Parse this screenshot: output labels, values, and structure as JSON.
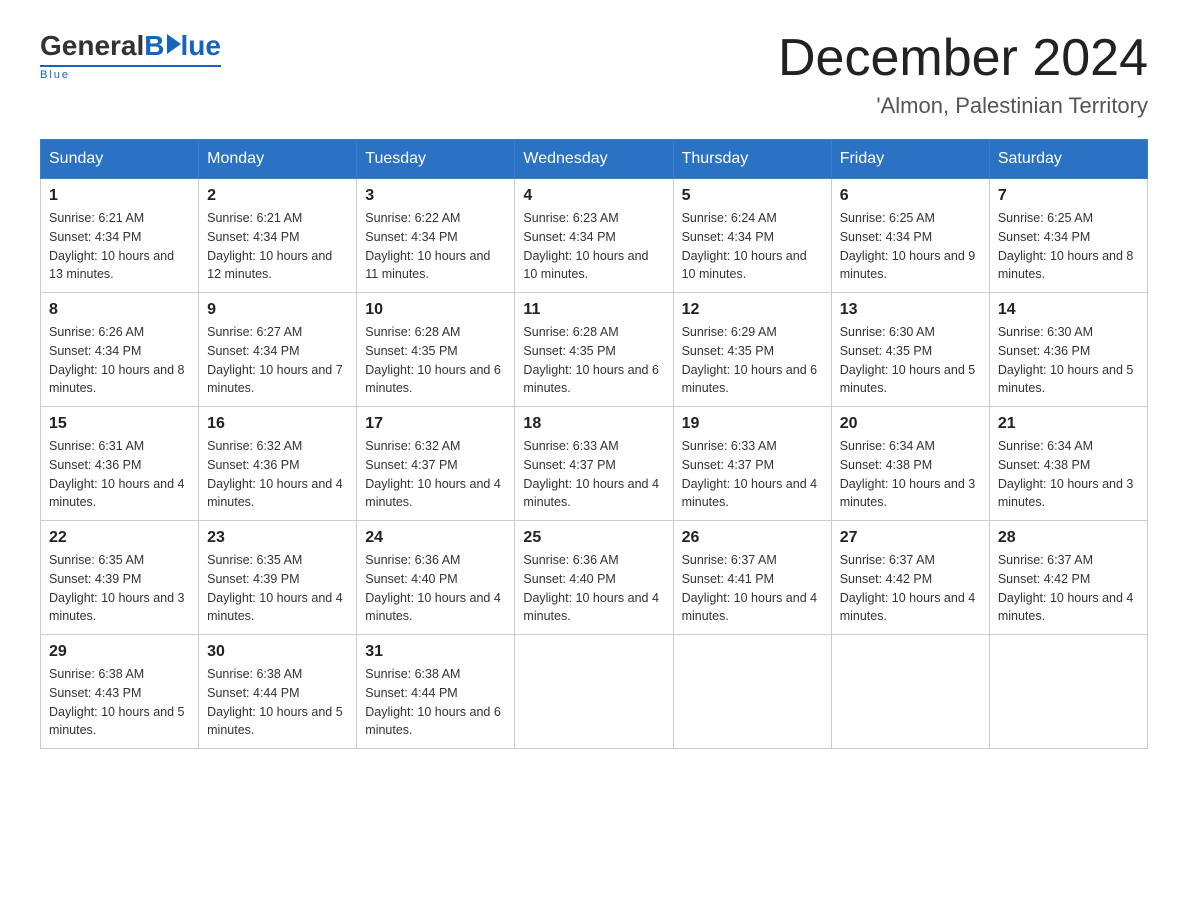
{
  "logo": {
    "general": "General",
    "blue": "Blue",
    "tagline": "Blue"
  },
  "header": {
    "month": "December 2024",
    "location": "'Almon, Palestinian Territory"
  },
  "days_of_week": [
    "Sunday",
    "Monday",
    "Tuesday",
    "Wednesday",
    "Thursday",
    "Friday",
    "Saturday"
  ],
  "weeks": [
    [
      {
        "day": "1",
        "sunrise": "6:21 AM",
        "sunset": "4:34 PM",
        "daylight": "10 hours and 13 minutes."
      },
      {
        "day": "2",
        "sunrise": "6:21 AM",
        "sunset": "4:34 PM",
        "daylight": "10 hours and 12 minutes."
      },
      {
        "day": "3",
        "sunrise": "6:22 AM",
        "sunset": "4:34 PM",
        "daylight": "10 hours and 11 minutes."
      },
      {
        "day": "4",
        "sunrise": "6:23 AM",
        "sunset": "4:34 PM",
        "daylight": "10 hours and 10 minutes."
      },
      {
        "day": "5",
        "sunrise": "6:24 AM",
        "sunset": "4:34 PM",
        "daylight": "10 hours and 10 minutes."
      },
      {
        "day": "6",
        "sunrise": "6:25 AM",
        "sunset": "4:34 PM",
        "daylight": "10 hours and 9 minutes."
      },
      {
        "day": "7",
        "sunrise": "6:25 AM",
        "sunset": "4:34 PM",
        "daylight": "10 hours and 8 minutes."
      }
    ],
    [
      {
        "day": "8",
        "sunrise": "6:26 AM",
        "sunset": "4:34 PM",
        "daylight": "10 hours and 8 minutes."
      },
      {
        "day": "9",
        "sunrise": "6:27 AM",
        "sunset": "4:34 PM",
        "daylight": "10 hours and 7 minutes."
      },
      {
        "day": "10",
        "sunrise": "6:28 AM",
        "sunset": "4:35 PM",
        "daylight": "10 hours and 6 minutes."
      },
      {
        "day": "11",
        "sunrise": "6:28 AM",
        "sunset": "4:35 PM",
        "daylight": "10 hours and 6 minutes."
      },
      {
        "day": "12",
        "sunrise": "6:29 AM",
        "sunset": "4:35 PM",
        "daylight": "10 hours and 6 minutes."
      },
      {
        "day": "13",
        "sunrise": "6:30 AM",
        "sunset": "4:35 PM",
        "daylight": "10 hours and 5 minutes."
      },
      {
        "day": "14",
        "sunrise": "6:30 AM",
        "sunset": "4:36 PM",
        "daylight": "10 hours and 5 minutes."
      }
    ],
    [
      {
        "day": "15",
        "sunrise": "6:31 AM",
        "sunset": "4:36 PM",
        "daylight": "10 hours and 4 minutes."
      },
      {
        "day": "16",
        "sunrise": "6:32 AM",
        "sunset": "4:36 PM",
        "daylight": "10 hours and 4 minutes."
      },
      {
        "day": "17",
        "sunrise": "6:32 AM",
        "sunset": "4:37 PM",
        "daylight": "10 hours and 4 minutes."
      },
      {
        "day": "18",
        "sunrise": "6:33 AM",
        "sunset": "4:37 PM",
        "daylight": "10 hours and 4 minutes."
      },
      {
        "day": "19",
        "sunrise": "6:33 AM",
        "sunset": "4:37 PM",
        "daylight": "10 hours and 4 minutes."
      },
      {
        "day": "20",
        "sunrise": "6:34 AM",
        "sunset": "4:38 PM",
        "daylight": "10 hours and 3 minutes."
      },
      {
        "day": "21",
        "sunrise": "6:34 AM",
        "sunset": "4:38 PM",
        "daylight": "10 hours and 3 minutes."
      }
    ],
    [
      {
        "day": "22",
        "sunrise": "6:35 AM",
        "sunset": "4:39 PM",
        "daylight": "10 hours and 3 minutes."
      },
      {
        "day": "23",
        "sunrise": "6:35 AM",
        "sunset": "4:39 PM",
        "daylight": "10 hours and 4 minutes."
      },
      {
        "day": "24",
        "sunrise": "6:36 AM",
        "sunset": "4:40 PM",
        "daylight": "10 hours and 4 minutes."
      },
      {
        "day": "25",
        "sunrise": "6:36 AM",
        "sunset": "4:40 PM",
        "daylight": "10 hours and 4 minutes."
      },
      {
        "day": "26",
        "sunrise": "6:37 AM",
        "sunset": "4:41 PM",
        "daylight": "10 hours and 4 minutes."
      },
      {
        "day": "27",
        "sunrise": "6:37 AM",
        "sunset": "4:42 PM",
        "daylight": "10 hours and 4 minutes."
      },
      {
        "day": "28",
        "sunrise": "6:37 AM",
        "sunset": "4:42 PM",
        "daylight": "10 hours and 4 minutes."
      }
    ],
    [
      {
        "day": "29",
        "sunrise": "6:38 AM",
        "sunset": "4:43 PM",
        "daylight": "10 hours and 5 minutes."
      },
      {
        "day": "30",
        "sunrise": "6:38 AM",
        "sunset": "4:44 PM",
        "daylight": "10 hours and 5 minutes."
      },
      {
        "day": "31",
        "sunrise": "6:38 AM",
        "sunset": "4:44 PM",
        "daylight": "10 hours and 6 minutes."
      },
      null,
      null,
      null,
      null
    ]
  ],
  "labels": {
    "sunrise": "Sunrise:",
    "sunset": "Sunset:",
    "daylight": "Daylight:"
  }
}
